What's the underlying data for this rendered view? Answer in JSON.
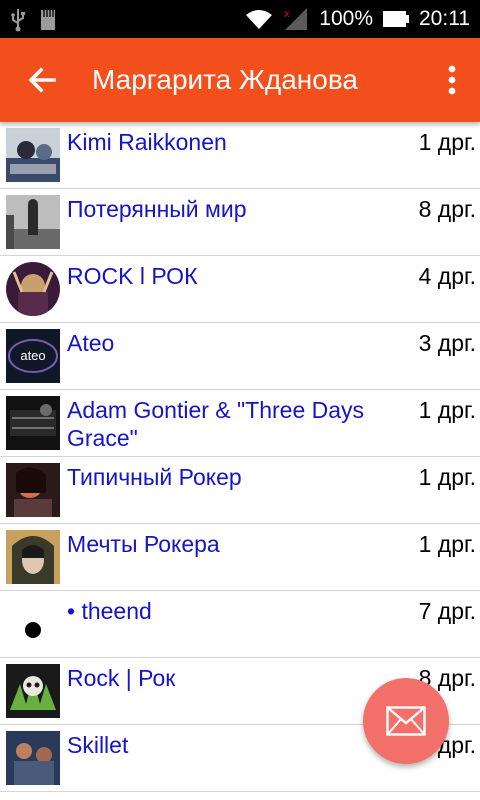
{
  "status_bar": {
    "battery": "100%",
    "time": "20:11"
  },
  "app_bar": {
    "title": "Маргарита Жданова"
  },
  "groups": [
    {
      "name": "Kimi Raikkonen",
      "count": "1 дрг.",
      "icon": "racer-photo",
      "avatar_colors": [
        "#3a4a6a",
        "#c8d0d8"
      ]
    },
    {
      "name": "Потерянный мир",
      "count": "8 дрг.",
      "icon": "figure-photo",
      "avatar_colors": [
        "#4a4a4a",
        "#bdbdbd"
      ]
    },
    {
      "name": "ROCK l РОК",
      "count": "4 дрг.",
      "icon": "concert-photo",
      "avatar_colors": [
        "#3a1a3a",
        "#c8a070"
      ]
    },
    {
      "name": "Ateo",
      "count": "3 дрг.",
      "icon": "ateo-logo",
      "avatar_colors": [
        "#101828",
        "#7a5ab0"
      ]
    },
    {
      "name": "Adam Gontier & \"Three Days Grace\"",
      "count": "1 дрг.",
      "icon": "band-photo",
      "avatar_colors": [
        "#111111",
        "#8a8a8a"
      ]
    },
    {
      "name": "Типичный Рокер",
      "count": "1 дрг.",
      "icon": "singer-photo",
      "avatar_colors": [
        "#2a1a1a",
        "#d07050"
      ]
    },
    {
      "name": "Мечты Рокера",
      "count": "1 дрг.",
      "icon": "portrait-photo",
      "avatar_colors": [
        "#3a3a2a",
        "#c8a060"
      ]
    },
    {
      "name": "• theend",
      "count": "7 дрг.",
      "icon": "black-dot",
      "avatar_colors": [
        "#ffffff",
        "#000000"
      ]
    },
    {
      "name": "Rock | Рок",
      "count": "8 дрг.",
      "icon": "skull-photo",
      "avatar_colors": [
        "#1a1a1a",
        "#6ab040"
      ]
    },
    {
      "name": "Skillet",
      "count": "3 дрг.",
      "icon": "band-photo",
      "avatar_colors": [
        "#2a3a5a",
        "#c08060"
      ]
    }
  ],
  "fab": {
    "icon": "envelope-icon",
    "color": "#f26f6a"
  },
  "colors": {
    "app_bar": "#f24f1c",
    "link": "#1414c8"
  }
}
